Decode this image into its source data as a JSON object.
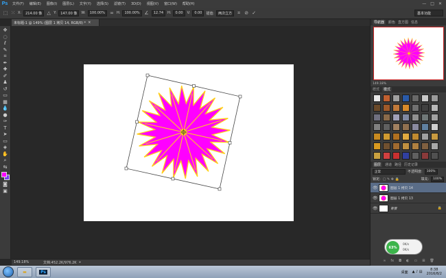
{
  "app": {
    "logo": "Ps",
    "menu": [
      "文件(F)",
      "编辑(E)",
      "图像(I)",
      "图层(L)",
      "文字(Y)",
      "选择(S)",
      "滤镜(T)",
      "3D(D)",
      "视图(V)",
      "窗口(W)",
      "帮助(H)"
    ],
    "window_controls": [
      "—",
      "□",
      "✕"
    ]
  },
  "options": {
    "x_label": "X:",
    "x_value": "214.00 像",
    "y_label": "Y:",
    "y_value": "147.00 像",
    "w_label": "W:",
    "w_value": "100.00%",
    "h_label": "H:",
    "h_value": "100.00%",
    "angle_value": "12.74",
    "hskew_label": "H:",
    "hskew_value": "0.00",
    "vskew_label": "V:",
    "vskew_value": "0.00",
    "interp_label": "插值:",
    "interp_value": "两次立方",
    "workspace": "基本功能"
  },
  "document": {
    "tab_title": "未标题-1 @ 149% (图层 1 拷贝 14, RGB/8) *",
    "close": "×",
    "zoom_status": "149.18%",
    "doc_status": "文档:452.2K/976.2K",
    "flower_color": "#ff00ff",
    "flower_outline": "#ffd21a"
  },
  "navigator": {
    "tabs": [
      "导航器",
      "颜色",
      "直方图",
      "信息"
    ],
    "zoom": "149.18%"
  },
  "styles": {
    "tabs": [
      "样式",
      "模式"
    ],
    "swatches": [
      "#e8e8e8",
      "#c06030",
      "#a0a0a0",
      "#2a5aa8",
      "#686868",
      "#c8c8c8",
      "#9a9a9a",
      "#6b4a2a",
      "#a05a2a",
      "#c07a3a",
      "#d88a2a",
      "#707070",
      "#404040",
      "#b8b8b8",
      "#707080",
      "#8a6a4a",
      "#a0a0b8",
      "#8088a0",
      "#909090",
      "#707878",
      "#a0a0a0",
      "#808080",
      "#606060",
      "#a08060",
      "#907050",
      "#8a8aa0",
      "#6080a0",
      "#d0d0d0",
      "#c88a20",
      "#d09a30",
      "#b07020",
      "#e0aa40",
      "#c08a30",
      "#a0a0a0",
      "#c89a40",
      "#d89a20",
      "#705030",
      "#a06a30",
      "#c09040",
      "#b08040",
      "#806040",
      "#a8a8a8",
      "#c8a040",
      "#d04040",
      "#c83030",
      "#3040a0",
      "#606060",
      "#8a3a3a",
      "#505050"
    ]
  },
  "layers": {
    "tabs": [
      "图层",
      "通道",
      "路径",
      "历史记录"
    ],
    "blend_mode": "正常",
    "opacity_label": "不透明度:",
    "opacity_value": "100%",
    "lock_label": "锁定:",
    "fill_label": "填充:",
    "fill_value": "100%",
    "items": [
      {
        "name": "图层 1 拷贝 14",
        "selected": true,
        "flower": true
      },
      {
        "name": "图层 1 拷贝 13",
        "selected": false,
        "flower": true
      },
      {
        "name": "背景",
        "selected": false,
        "flower": false
      }
    ]
  },
  "widget": {
    "percent": "63%",
    "line1": "0K/s",
    "line2": "0K/s"
  },
  "taskbar": {
    "ps_label": "Ps",
    "tray_label": "桌面",
    "time": "8:38",
    "date": "2016/8/2"
  }
}
